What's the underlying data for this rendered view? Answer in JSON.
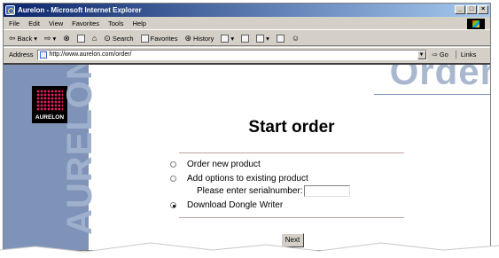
{
  "window": {
    "title": "Aurelon - Microsoft Internet Explorer",
    "controls": [
      "_",
      "□",
      "×"
    ]
  },
  "menubar": {
    "items": [
      "File",
      "Edit",
      "View",
      "Favorites",
      "Tools",
      "Help"
    ]
  },
  "toolbar": {
    "back": "Back",
    "search": "Search",
    "favorites": "Favorites",
    "history": "History"
  },
  "addressbar": {
    "label": "Address",
    "url": "http://www.aurelon.com/order/",
    "go": "Go",
    "links": "Links"
  },
  "page": {
    "logo_text": "AURELON",
    "sidebar_word": "AURELON",
    "header_word": "Order",
    "title": "Start order",
    "options": [
      {
        "label": "Order new product",
        "selected": false
      },
      {
        "label": "Add options to existing product",
        "selected": false
      },
      {
        "label": "Download Dongle Writer",
        "selected": true
      }
    ],
    "serial_label": "Please enter serialnumber:",
    "serial_value": "",
    "next_label": "Next"
  },
  "colors": {
    "sidebar": "#7f93b8",
    "title_gradient_start": "#0a246a",
    "chrome": "#d4d0c8"
  }
}
